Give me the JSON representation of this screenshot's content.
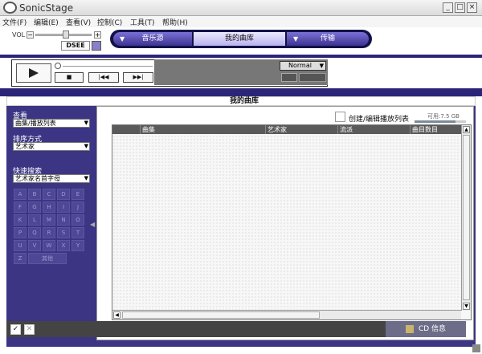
{
  "window": {
    "title": "SonicStage",
    "minimize": "_",
    "maximize": "□",
    "close": "×"
  },
  "menu": {
    "items": [
      "文件(F)",
      "编辑(E)",
      "查看(V)",
      "控制(C)",
      "工具(T)",
      "帮助(H)"
    ]
  },
  "volume": {
    "label": "VOL",
    "minus": "−",
    "plus": "+",
    "level_fraction": 0.55
  },
  "dsee": {
    "label": "DSEE"
  },
  "tabs": {
    "music": "音乐源",
    "library": "我的曲库",
    "transfer": "传输",
    "arrow": "▼"
  },
  "player": {
    "play_mode": "Normal",
    "dropdown_arrow": "▼",
    "stop": "■",
    "prev": "|◀◀",
    "next": "▶▶|"
  },
  "library": {
    "title": "我的曲库",
    "view_label": "查看",
    "view_value": "曲集/播放列表",
    "sort_label": "排序方式",
    "sort_value": "艺术家",
    "quick_search_label": "快速搜索",
    "quick_search_value": "艺术家名首字母",
    "dropdown_arrow": "▼",
    "az": [
      "A",
      "B",
      "C",
      "D",
      "E",
      "F",
      "G",
      "H",
      "I",
      "J",
      "K",
      "L",
      "M",
      "N",
      "O",
      "P",
      "Q",
      "R",
      "S",
      "T",
      "U",
      "V",
      "W",
      "X",
      "Y",
      "Z",
      "其他"
    ],
    "collapse_arrow": "◀",
    "create_playlist_label": "创建/编辑播放列表",
    "available": "可用:7.5 GB",
    "available_fraction": 0.8,
    "columns": [
      "曲集",
      "艺术家",
      "流派",
      "曲目数目"
    ],
    "scroll_up": "▲",
    "scroll_down": "▼",
    "scroll_left": "◀",
    "check": "✓",
    "uncheck": "✕",
    "cd_info": "CD 信息"
  }
}
